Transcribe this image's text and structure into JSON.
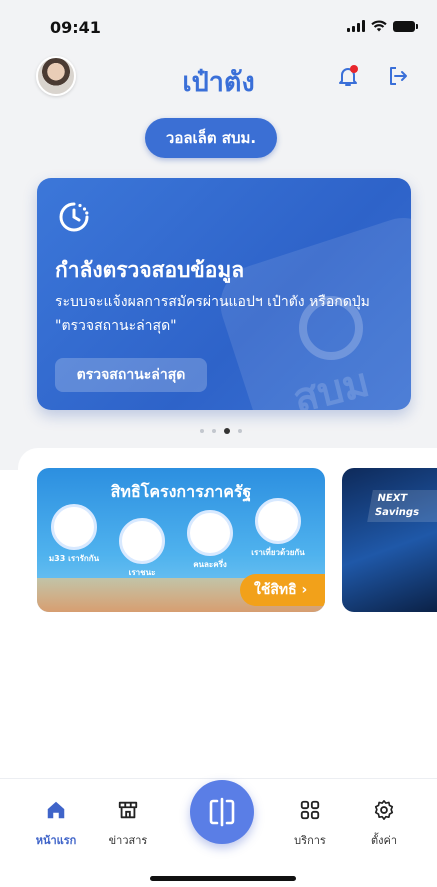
{
  "status_bar": {
    "time": "09:41"
  },
  "header": {
    "title": "เป๋าตัง"
  },
  "wallet_button": {
    "label": "วอลเล็ต สบม."
  },
  "status_card": {
    "title": "กำลังตรวจสอบข้อมูล",
    "description": "ระบบจะแจ้งผลการสมัครผ่านแอปฯ เป๋าตัง หรือกดปุ่ม \"ตรวจสถานะล่าสุด\"",
    "button_label": "ตรวจสถานะล่าสุด",
    "watermark": "สบม"
  },
  "carousel": {
    "pages": 4,
    "active_index": 2
  },
  "gov_banner": {
    "title": "สิทธิโครงการภาครัฐ",
    "programs": [
      "เราชนะ",
      "คนละครึ่ง",
      "เราเที่ยวด้วยกัน",
      "ม33 เรารักกัน"
    ],
    "button_label": "ใช้สิทธิ"
  },
  "savings_banner": {
    "label": "NEXT Savings"
  },
  "bottom_nav": {
    "items": [
      {
        "label": "หน้าแรก",
        "icon": "home-icon",
        "active": true
      },
      {
        "label": "ข่าวสาร",
        "icon": "storefront-icon",
        "active": false
      },
      {
        "label": "บริการ",
        "icon": "grid-icon",
        "active": false
      },
      {
        "label": "ตั้งค่า",
        "icon": "gear-icon",
        "active": false
      }
    ],
    "scan_icon": "scan-icon"
  },
  "colors": {
    "brand": "#3a6fd8",
    "card": "#3c77d9",
    "accent_orange": "#f2a11a",
    "notification": "#e8262b",
    "nav_active": "#3f64c9"
  }
}
